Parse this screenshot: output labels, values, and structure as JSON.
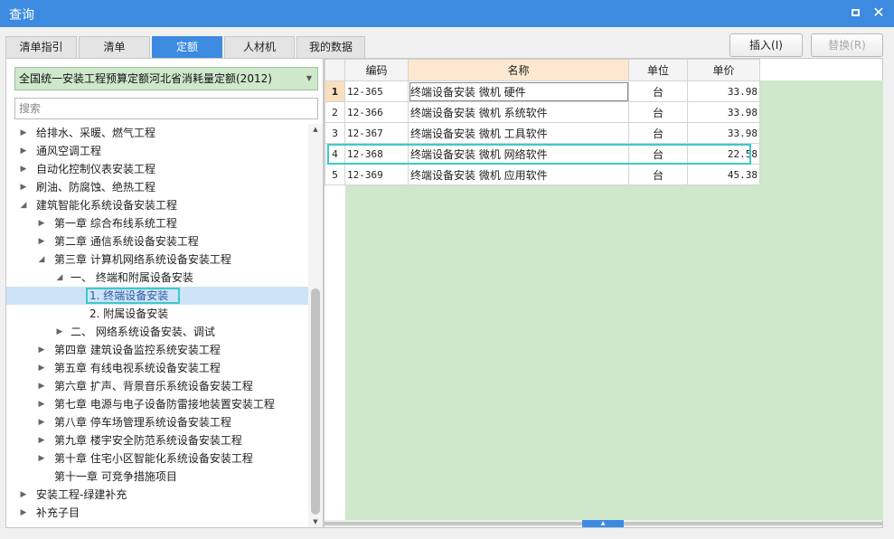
{
  "window": {
    "title": "查询"
  },
  "tabs": [
    {
      "label": "清单指引"
    },
    {
      "label": "清单"
    },
    {
      "label": "定额"
    },
    {
      "label": "人材机"
    },
    {
      "label": "我的数据"
    }
  ],
  "active_tab": "定额",
  "actions": {
    "insert_label": "插入(I)",
    "replace_label": "替换(R)"
  },
  "library": {
    "selected": "全国统一安装工程预算定额河北省消耗量定额(2012)"
  },
  "search": {
    "placeholder": "搜索"
  },
  "tree": [
    {
      "label": "给排水、采暖、燃气工程",
      "expanded": false
    },
    {
      "label": "通风空调工程",
      "expanded": false
    },
    {
      "label": "自动化控制仪表安装工程",
      "expanded": false
    },
    {
      "label": "刷油、防腐蚀、绝热工程",
      "expanded": false
    },
    {
      "label": "建筑智能化系统设备安装工程",
      "expanded": true
    },
    {
      "label": "第一章 综合布线系统工程",
      "expanded": false
    },
    {
      "label": "第二章 通信系统设备安装工程",
      "expanded": false
    },
    {
      "label": "第三章 计算机网络系统设备安装工程",
      "expanded": true
    },
    {
      "label": "一、 终端和附属设备安装",
      "expanded": true
    },
    {
      "label": "1. 终端设备安装",
      "selected": true
    },
    {
      "label": "2. 附属设备安装"
    },
    {
      "label": "二、 网络系统设备安装、调试",
      "expanded": false
    },
    {
      "label": "第四章 建筑设备监控系统安装工程",
      "expanded": false
    },
    {
      "label": "第五章 有线电视系统设备安装工程",
      "expanded": false
    },
    {
      "label": "第六章 扩声、背景音乐系统设备安装工程",
      "expanded": false
    },
    {
      "label": "第七章 电源与电子设备防雷接地装置安装工程",
      "expanded": false
    },
    {
      "label": "第八章 停车场管理系统设备安装工程",
      "expanded": false
    },
    {
      "label": "第九章 楼宇安全防范系统设备安装工程",
      "expanded": false
    },
    {
      "label": "第十章 住宅小区智能化系统设备安装工程",
      "expanded": false
    },
    {
      "label": "第十一章 可竞争措施项目"
    },
    {
      "label": "安装工程-绿建补充",
      "expanded": false
    },
    {
      "label": "补充子目",
      "expanded": false
    }
  ],
  "grid": {
    "columns": {
      "code": "编码",
      "name": "名称",
      "unit": "单位",
      "price": "单价"
    },
    "rows": [
      {
        "index": "1",
        "code": "12-365",
        "name": "终端设备安装 微机 硬件",
        "unit": "台",
        "price": "33.98"
      },
      {
        "index": "2",
        "code": "12-366",
        "name": "终端设备安装 微机 系统软件",
        "unit": "台",
        "price": "33.98"
      },
      {
        "index": "3",
        "code": "12-367",
        "name": "终端设备安装 微机 工具软件",
        "unit": "台",
        "price": "33.98"
      },
      {
        "index": "4",
        "code": "12-368",
        "name": "终端设备安装 微机 网络软件",
        "unit": "台",
        "price": "22.58"
      },
      {
        "index": "5",
        "code": "12-369",
        "name": "终端设备安装 微机 应用软件",
        "unit": "台",
        "price": "45.38"
      }
    ]
  },
  "colors": {
    "accent": "#3d8be0",
    "grid_fill": "#cfe8cc",
    "highlight": "#3ec8c8",
    "selected_row": "#cde3f7"
  },
  "icons": {
    "maximize": "maximize-icon",
    "close": "close-icon",
    "expand": "chevron-right-icon",
    "collapse": "chevron-down-icon"
  }
}
